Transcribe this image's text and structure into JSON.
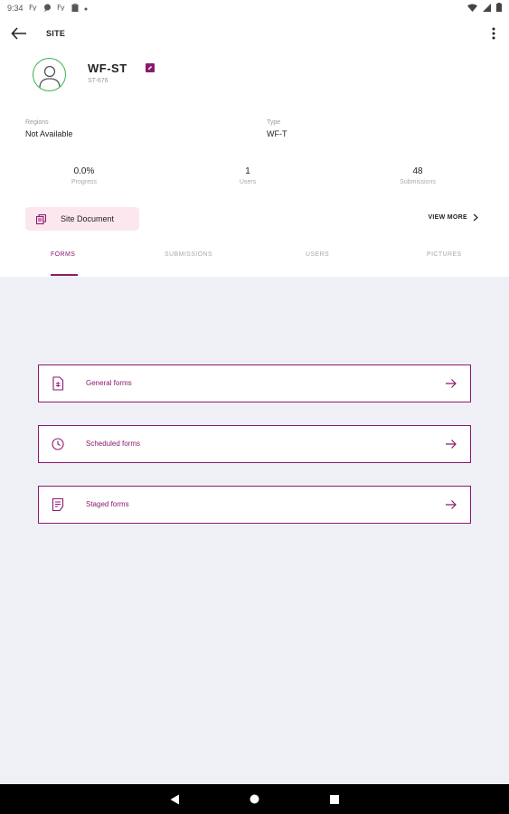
{
  "status_bar": {
    "time": "9:34"
  },
  "app_bar": {
    "title": "SITE"
  },
  "site": {
    "name": "WF-ST",
    "code": "ST-676"
  },
  "info": {
    "regions_label": "Regions",
    "regions_value": "Not Available",
    "type_label": "Type",
    "type_value": "WF-T"
  },
  "stats": [
    {
      "value": "0.0%",
      "label": "Progress"
    },
    {
      "value": "1",
      "label": "Users"
    },
    {
      "value": "48",
      "label": "Submissions"
    }
  ],
  "site_document": {
    "label": "Site Document"
  },
  "view_more": {
    "label": "VIEW MORE"
  },
  "tabs": [
    {
      "label": "FORMS",
      "active": true
    },
    {
      "label": "SUBMISSIONS",
      "active": false
    },
    {
      "label": "USERS",
      "active": false
    },
    {
      "label": "PICTURES",
      "active": false
    }
  ],
  "forms": [
    {
      "label": "General forms",
      "icon": "document-icon"
    },
    {
      "label": "Scheduled forms",
      "icon": "clock-icon"
    },
    {
      "label": "Staged forms",
      "icon": "checklist-icon"
    }
  ],
  "colors": {
    "accent": "#8b1a6f",
    "avatar_ring": "#3fb24f",
    "chip_bg": "#fde7ef",
    "content_bg": "#eff0f6"
  }
}
